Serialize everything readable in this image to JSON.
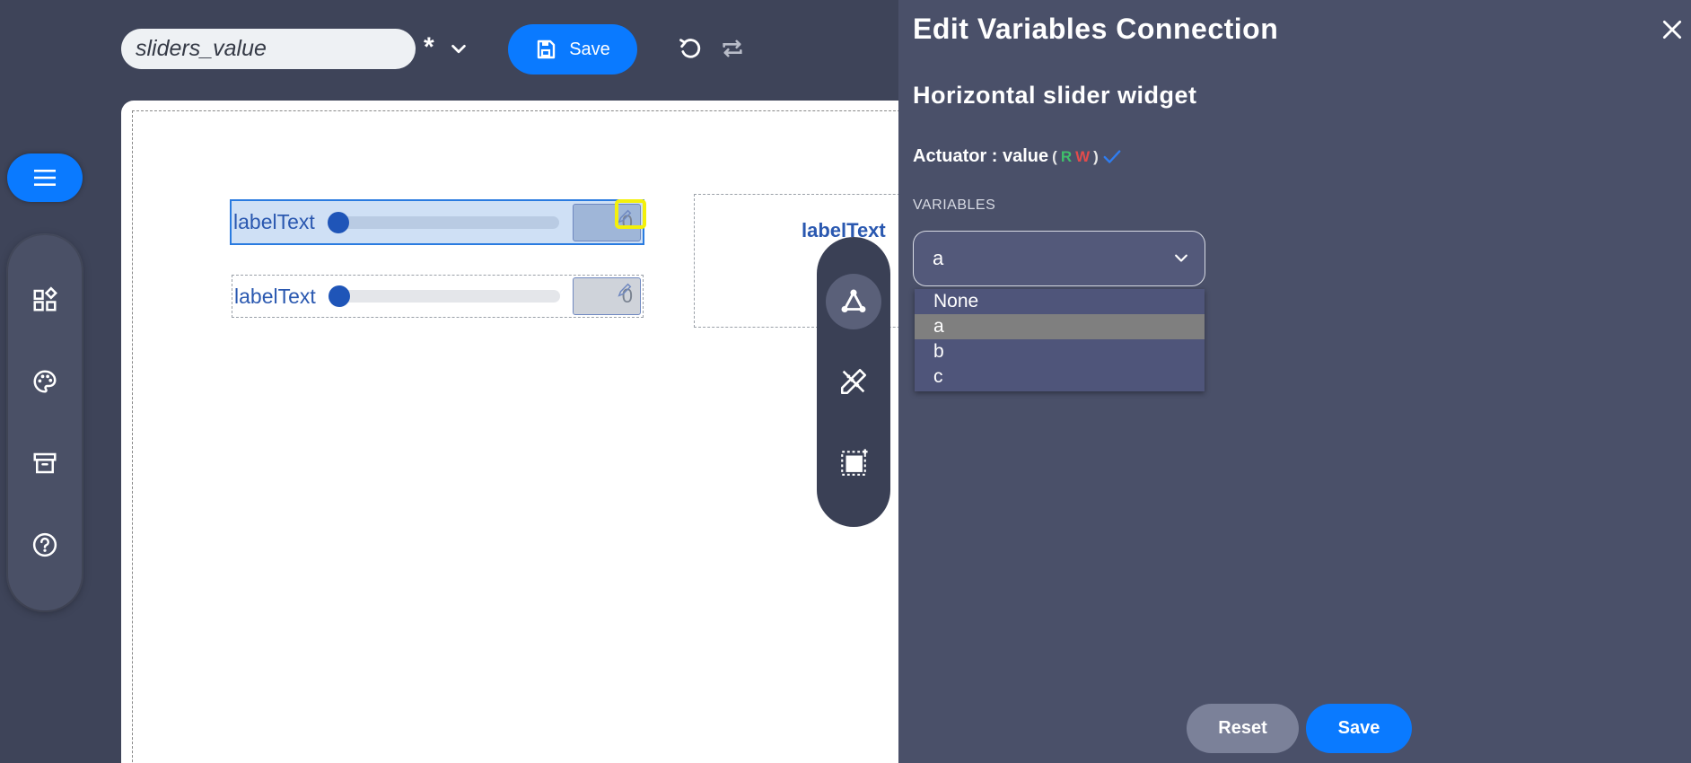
{
  "topbar": {
    "name_value": "sliders_value",
    "modified_marker": "*",
    "save_label": "Save"
  },
  "icons": {
    "menu": "hamburger-icon",
    "widgets": "widgets-icon",
    "theme": "palette-icon",
    "archive": "archive-icon",
    "help": "help-icon",
    "connect": "connection-icon",
    "design": "design-tools-icon",
    "resize": "resize-icon"
  },
  "canvas": {
    "widgets": [
      {
        "label": "labelText",
        "value": "0"
      },
      {
        "label": "labelText",
        "value": "0"
      }
    ],
    "third_label": "labelText"
  },
  "panel": {
    "title": "Edit Variables Connection",
    "subtitle": "Horizontal slider widget",
    "actuator_text": "Actuator : value",
    "rw_open": "(",
    "rw_r": "R",
    "rw_w": "W",
    "rw_close": ")",
    "variables_label": "VARIABLES",
    "selected_value": "a",
    "options": [
      "None",
      "a",
      "b",
      "c"
    ],
    "reset_label": "Reset",
    "save_label": "Save"
  },
  "colors": {
    "accent": "#0a7aff",
    "panel_bg": "#4a5069",
    "app_bg": "#3e4459",
    "highlight": "#f3f00b"
  }
}
